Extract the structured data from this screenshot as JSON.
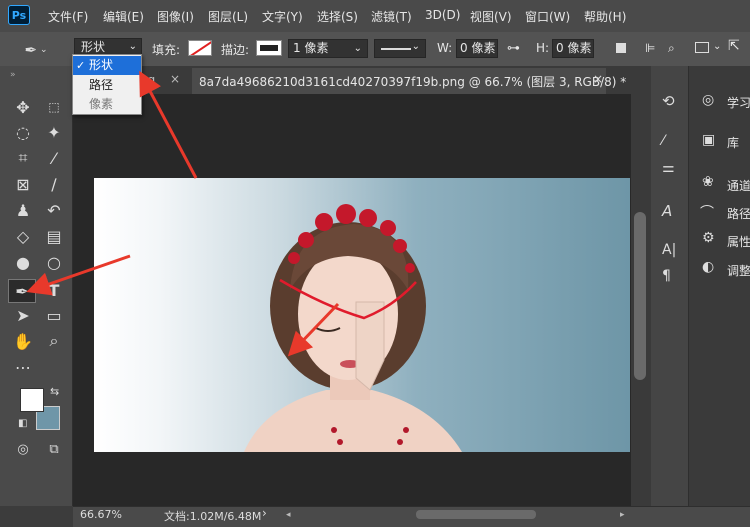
{
  "menu": {
    "logo": "Ps",
    "items": [
      "文件(F)",
      "编辑(E)",
      "图像(I)",
      "图层(L)",
      "文字(Y)",
      "选择(S)",
      "滤镜(T)",
      "3D(D)",
      "视图(V)",
      "窗口(W)",
      "帮助(H)"
    ]
  },
  "options": {
    "mode_value": "形状",
    "fill_label": "填充:",
    "stroke_label": "描边:",
    "stroke_width": "1 像素",
    "w_label": "W:",
    "w_value": "0 像素",
    "h_label": "H:",
    "h_value": "0 像素"
  },
  "dropdown": {
    "items": [
      "形状",
      "路径",
      "像素"
    ],
    "selected_index": 0
  },
  "tabs": {
    "inactive_label": "pg",
    "active_label": "8a7da49686210d3161cd40270397f19b.png @ 66.7% (图层 3, RGB/8) *"
  },
  "right_panel": {
    "items": [
      "学习",
      "库",
      "通道",
      "路径",
      "属性",
      "调整"
    ]
  },
  "status": {
    "zoom": "66.67%",
    "doc_info": "文档:1.02M/6.48M"
  },
  "colors": {
    "foreground": "#ffffff",
    "background": "#6f96a8",
    "accent_arrow": "#e8392b",
    "dropdown_highlight": "#1e6fd9"
  }
}
